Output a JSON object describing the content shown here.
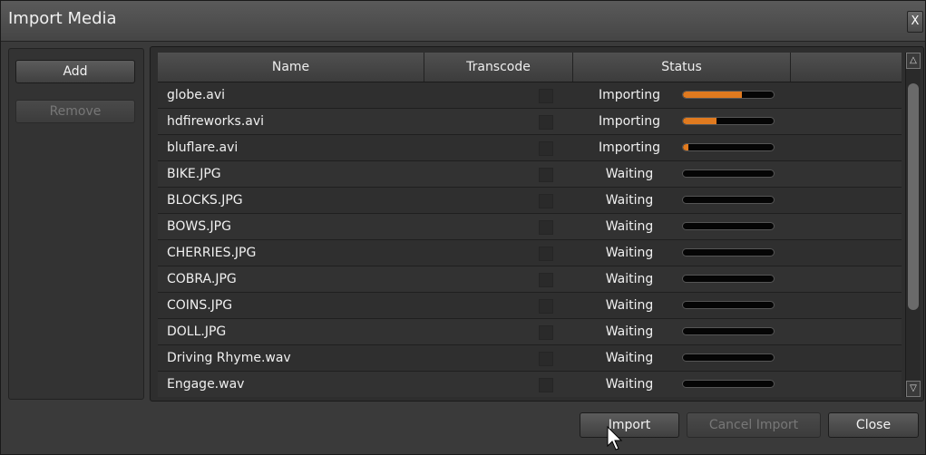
{
  "window": {
    "title": "Import Media",
    "close_label": "X"
  },
  "left_panel": {
    "add_label": "Add",
    "remove_label": "Remove"
  },
  "table": {
    "columns": [
      "Name",
      "Transcode",
      "Status",
      ""
    ],
    "rows": [
      {
        "name": "globe.avi",
        "status": "Importing",
        "progress": 0.65
      },
      {
        "name": "hdfireworks.avi",
        "status": "Importing",
        "progress": 0.37
      },
      {
        "name": "bluflare.avi",
        "status": "Importing",
        "progress": 0.06
      },
      {
        "name": "BIKE.JPG",
        "status": "Waiting",
        "progress": 0
      },
      {
        "name": "BLOCKS.JPG",
        "status": "Waiting",
        "progress": 0
      },
      {
        "name": "BOWS.JPG",
        "status": "Waiting",
        "progress": 0
      },
      {
        "name": "CHERRIES.JPG",
        "status": "Waiting",
        "progress": 0
      },
      {
        "name": "COBRA.JPG",
        "status": "Waiting",
        "progress": 0
      },
      {
        "name": "COINS.JPG",
        "status": "Waiting",
        "progress": 0
      },
      {
        "name": "DOLL.JPG",
        "status": "Waiting",
        "progress": 0
      },
      {
        "name": "Driving Rhyme.wav",
        "status": "Waiting",
        "progress": 0
      },
      {
        "name": "Engage.wav",
        "status": "Waiting",
        "progress": 0
      }
    ]
  },
  "footer": {
    "import_label": "Import",
    "cancel_import_label": "Cancel Import",
    "close_label": "Close"
  },
  "colors": {
    "progress": "#e07a1f",
    "accent": "#4a4a4a"
  }
}
